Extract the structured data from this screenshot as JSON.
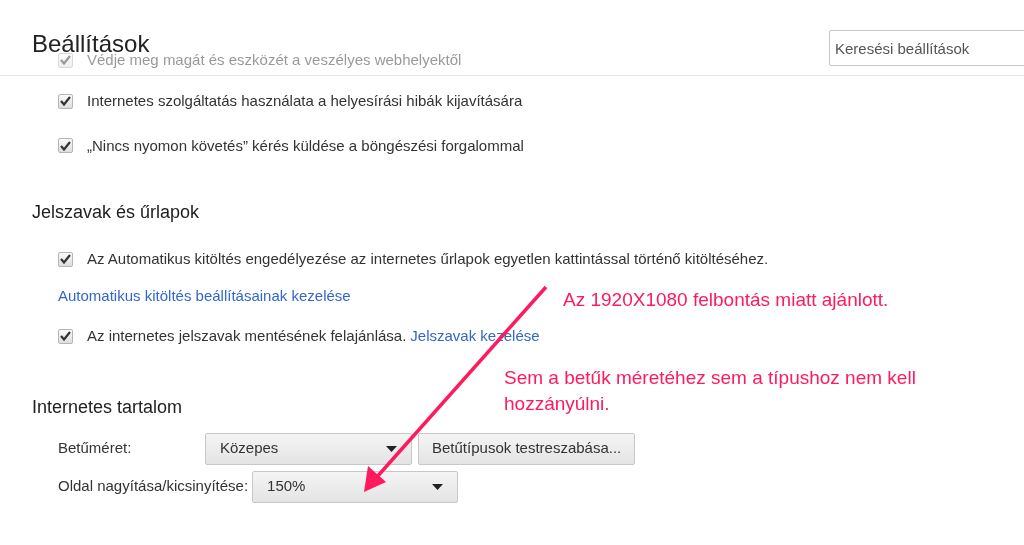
{
  "header": {
    "title": "Beállítások",
    "search": {
      "placeholder": "Keresési beállítások"
    }
  },
  "faded_row": {
    "label": "Védje meg magát és eszközét a veszélyes webhelyektől",
    "checked": true
  },
  "privacy_options": [
    {
      "label": "Internetes szolgáltatás használata a helyesírási hibák kijavítására",
      "checked": true
    },
    {
      "label": "„Nincs nyomon követés” kérés küldése a böngészési forgalommal",
      "checked": true
    }
  ],
  "passwords": {
    "heading": "Jelszavak és űrlapok",
    "autofill": {
      "label": "Az Automatikus kitöltés engedélyezése az internetes űrlapok egyetlen kattintással történő kitöltéséhez.",
      "checked": true
    },
    "autofill_link": "Automatikus kitöltés beállításainak kezelése",
    "save_passwords": {
      "label": "Az internetes jelszavak mentésének felajánlása.",
      "link": "Jelszavak kezelése",
      "checked": true
    }
  },
  "web_content": {
    "heading": "Internetes tartalom",
    "font_size": {
      "label": "Betűméret:",
      "value": "Közepes",
      "button": "Betűtípusok testreszabása..."
    },
    "zoom": {
      "label": "Oldal nagyítása/kicsinyítése:",
      "value": "150%"
    }
  },
  "annotations": [
    "Az 1920X1080 felbontás miatt ajánlott.",
    "Sem a betűk méretéhez sem a típushoz nem kell hozzányúlni."
  ]
}
